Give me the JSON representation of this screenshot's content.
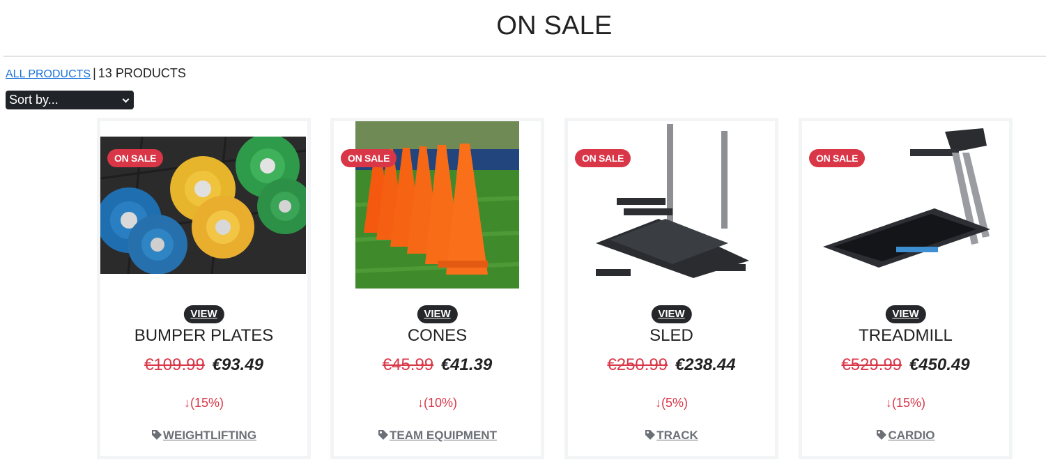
{
  "header": {
    "title": "ON SALE"
  },
  "breadcrumb": {
    "all_products": "ALL PRODUCTS",
    "separator": "|",
    "count": "13 PRODUCTS"
  },
  "sort": {
    "selected": "Sort by..."
  },
  "products": [
    {
      "badge": "ON SALE",
      "view": "VIEW",
      "name": "BUMPER PLATES",
      "old_price": "€109.99",
      "new_price": "€93.49",
      "discount": "(15%)",
      "category": "WEIGHTLIFTING"
    },
    {
      "badge": "ON SALE",
      "view": "VIEW",
      "name": "CONES",
      "old_price": "€45.99",
      "new_price": "€41.39",
      "discount": "(10%)",
      "category": "TEAM EQUIPMENT"
    },
    {
      "badge": "ON SALE",
      "view": "VIEW",
      "name": "SLED",
      "old_price": "€250.99",
      "new_price": "€238.44",
      "discount": "(5%)",
      "category": "TRACK"
    },
    {
      "badge": "ON SALE",
      "view": "VIEW",
      "name": "TREADMILL",
      "old_price": "€529.99",
      "new_price": "€450.49",
      "discount": "(15%)",
      "category": "CARDIO"
    }
  ],
  "colors": {
    "sale_red": "#d93647",
    "link_blue": "#1a73d9",
    "dark": "#202327"
  }
}
